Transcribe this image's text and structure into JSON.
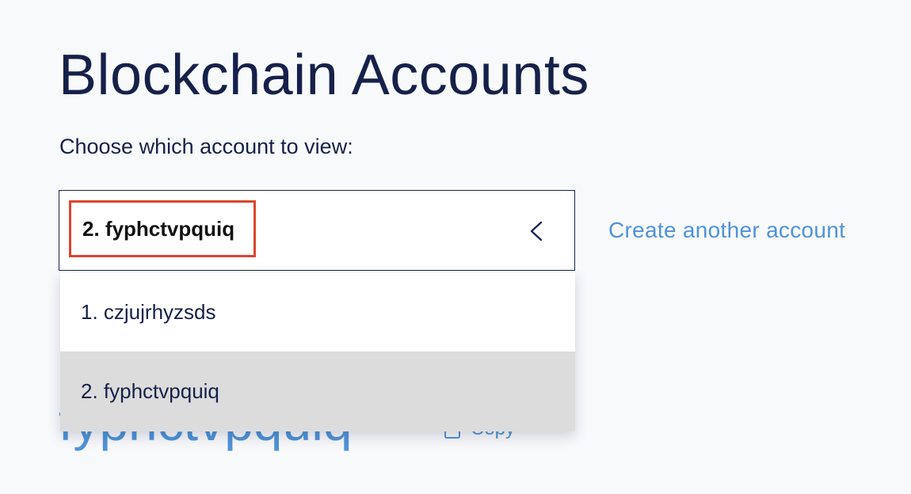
{
  "page": {
    "title": "Blockchain Accounts",
    "choose_label": "Choose which account to view:"
  },
  "selector": {
    "selected": "2. fyphctvpquiq",
    "toggle_icon": "chevron-left-icon"
  },
  "create_link": "Create another account",
  "dropdown": {
    "options": [
      {
        "label": "1. czjujrhyzsds",
        "highlighted": false
      },
      {
        "label": "2. fyphctvpquiq",
        "highlighted": true
      }
    ]
  },
  "account_detail": {
    "name": "fyphctvpquiq",
    "copy_label": "Copy",
    "copy_icon": "clipboard-icon"
  },
  "colors": {
    "title_text": "#16214a",
    "link": "#4f93d8",
    "highlight_border": "#d9472e",
    "option_highlight": "#dcdcdc",
    "background": "#f8f9fb"
  }
}
